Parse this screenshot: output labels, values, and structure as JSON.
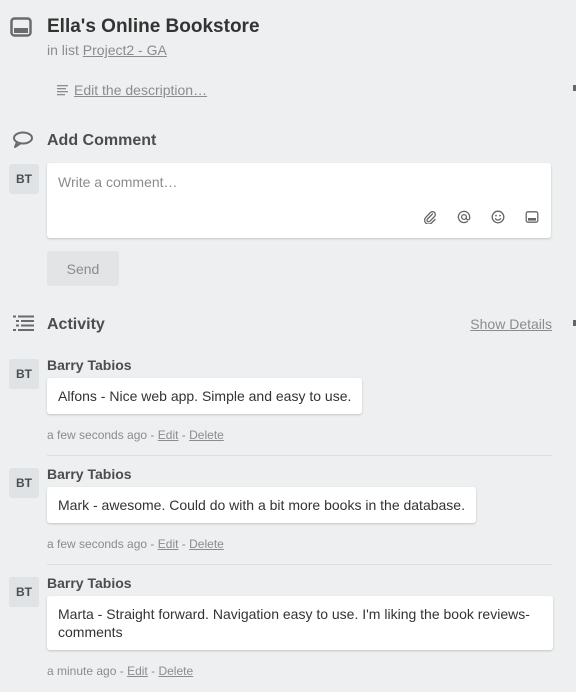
{
  "card": {
    "title": "Ella's Online Bookstore",
    "in_list_prefix": "in list",
    "list_name": "Project2 - GA",
    "edit_description": "Edit the description…"
  },
  "comment": {
    "section_title": "Add Comment",
    "avatar_initials": "BT",
    "placeholder": "Write a comment…",
    "tools": [
      "paperclip-icon",
      "at-mention-icon",
      "emoji-icon",
      "card-icon"
    ],
    "send_label": "Send"
  },
  "activity": {
    "section_title": "Activity",
    "show_details": "Show Details",
    "items": [
      {
        "initials": "BT",
        "author": "Barry Tabios",
        "text": "Alfons - Nice web app. Simple and easy to use.",
        "time": "a few seconds ago",
        "sep": "-",
        "edit": "Edit",
        "delete": "Delete"
      },
      {
        "initials": "BT",
        "author": "Barry Tabios",
        "text": "Mark - awesome. Could do with a bit more books in the database.",
        "time": "a few seconds ago",
        "sep": "-",
        "edit": "Edit",
        "delete": "Delete"
      },
      {
        "initials": "BT",
        "author": "Barry Tabios",
        "text_line1": "Marta - Straight forward. Navigation easy to use. I'm liking the book reviews-",
        "text_line2": "comments",
        "time": "a minute ago",
        "sep": "-",
        "edit": "Edit",
        "delete": "Delete"
      }
    ]
  }
}
